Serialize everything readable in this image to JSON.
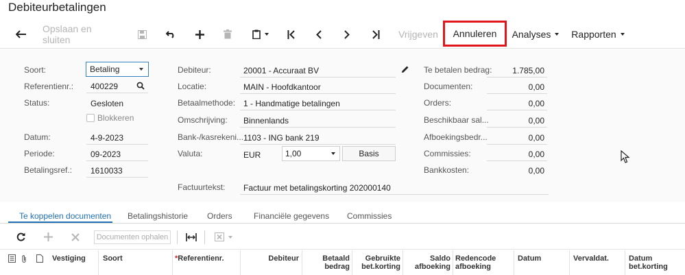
{
  "page": {
    "title": "Debiteurbetalingen"
  },
  "toolbar": {
    "save_close": "Opslaan en sluiten",
    "release": "Vrijgeven",
    "cancel": "Annuleren",
    "analyses": "Analyses",
    "reports": "Rapporten"
  },
  "form": {
    "type_label": "Soort:",
    "type_value": "Betaling",
    "ref_label": "Referentienr.:",
    "ref_value": "400229",
    "status_label": "Status:",
    "status_value": "Gesloten",
    "block_label": "Blokkeren",
    "date_label": "Datum:",
    "date_value": "4-9-2023",
    "period_label": "Periode:",
    "period_value": "09-2023",
    "payref_label": "Betalingsref.:",
    "payref_value": "1610033",
    "customer_label": "Debiteur:",
    "customer_value": "20001 - Accuraat BV",
    "location_label": "Locatie:",
    "location_value": "MAIN - Hoofdkantoor",
    "method_label": "Betaalmethode:",
    "method_value": "1 - Handmatige betalingen",
    "desc_label": "Omschrijving:",
    "desc_value": "Binnenlands",
    "bank_label": "Bank-/kasrekeni...",
    "bank_value": "1103 - ING bank 219",
    "currency_label": "Valuta:",
    "currency_value": "EUR",
    "rate_value": "1,00",
    "basis_button": "Basis",
    "invoice_text_label": "Factuurtekst:",
    "invoice_text_value": "Factuur met betalingskorting 202000140",
    "amount_due_label": "Te betalen bedrag:",
    "amount_due_value": "1.785,00",
    "documents_label": "Documenten:",
    "documents_value": "0,00",
    "orders_label": "Orders:",
    "orders_value": "0,00",
    "available_label": "Beschikbaar sal...",
    "available_value": "0,00",
    "writeoff_label": "Afboekingsbedr...",
    "writeoff_value": "0,00",
    "commissions_label": "Commissies:",
    "commissions_value": "0,00",
    "bankcosts_label": "Bankkosten:",
    "bankcosts_value": "0,00"
  },
  "tabs": [
    "Te koppelen documenten",
    "Betalingshistorie",
    "Orders",
    "Financiële gegevens",
    "Commissies"
  ],
  "grid": {
    "load_docs_button": "Documenten ophalen",
    "columns": {
      "branch": "Vestiging",
      "type": "Soort",
      "ref": "Referentienr.",
      "customer": "Debiteur",
      "paid_1": "Betaald",
      "paid_2": "bedrag",
      "used_1": "Gebruikte",
      "used_2": "bet.korting",
      "balance_1": "Saldo",
      "balance_2": "afboeking",
      "reason_1": "Redencode",
      "reason_2": "afboeking",
      "date": "Datum",
      "due": "Vervaldat.",
      "discdate_1": "Datum",
      "discdate_2": "bet.korting"
    }
  },
  "colors": {
    "accent": "#1f6fb5",
    "highlight": "#e0161b"
  }
}
